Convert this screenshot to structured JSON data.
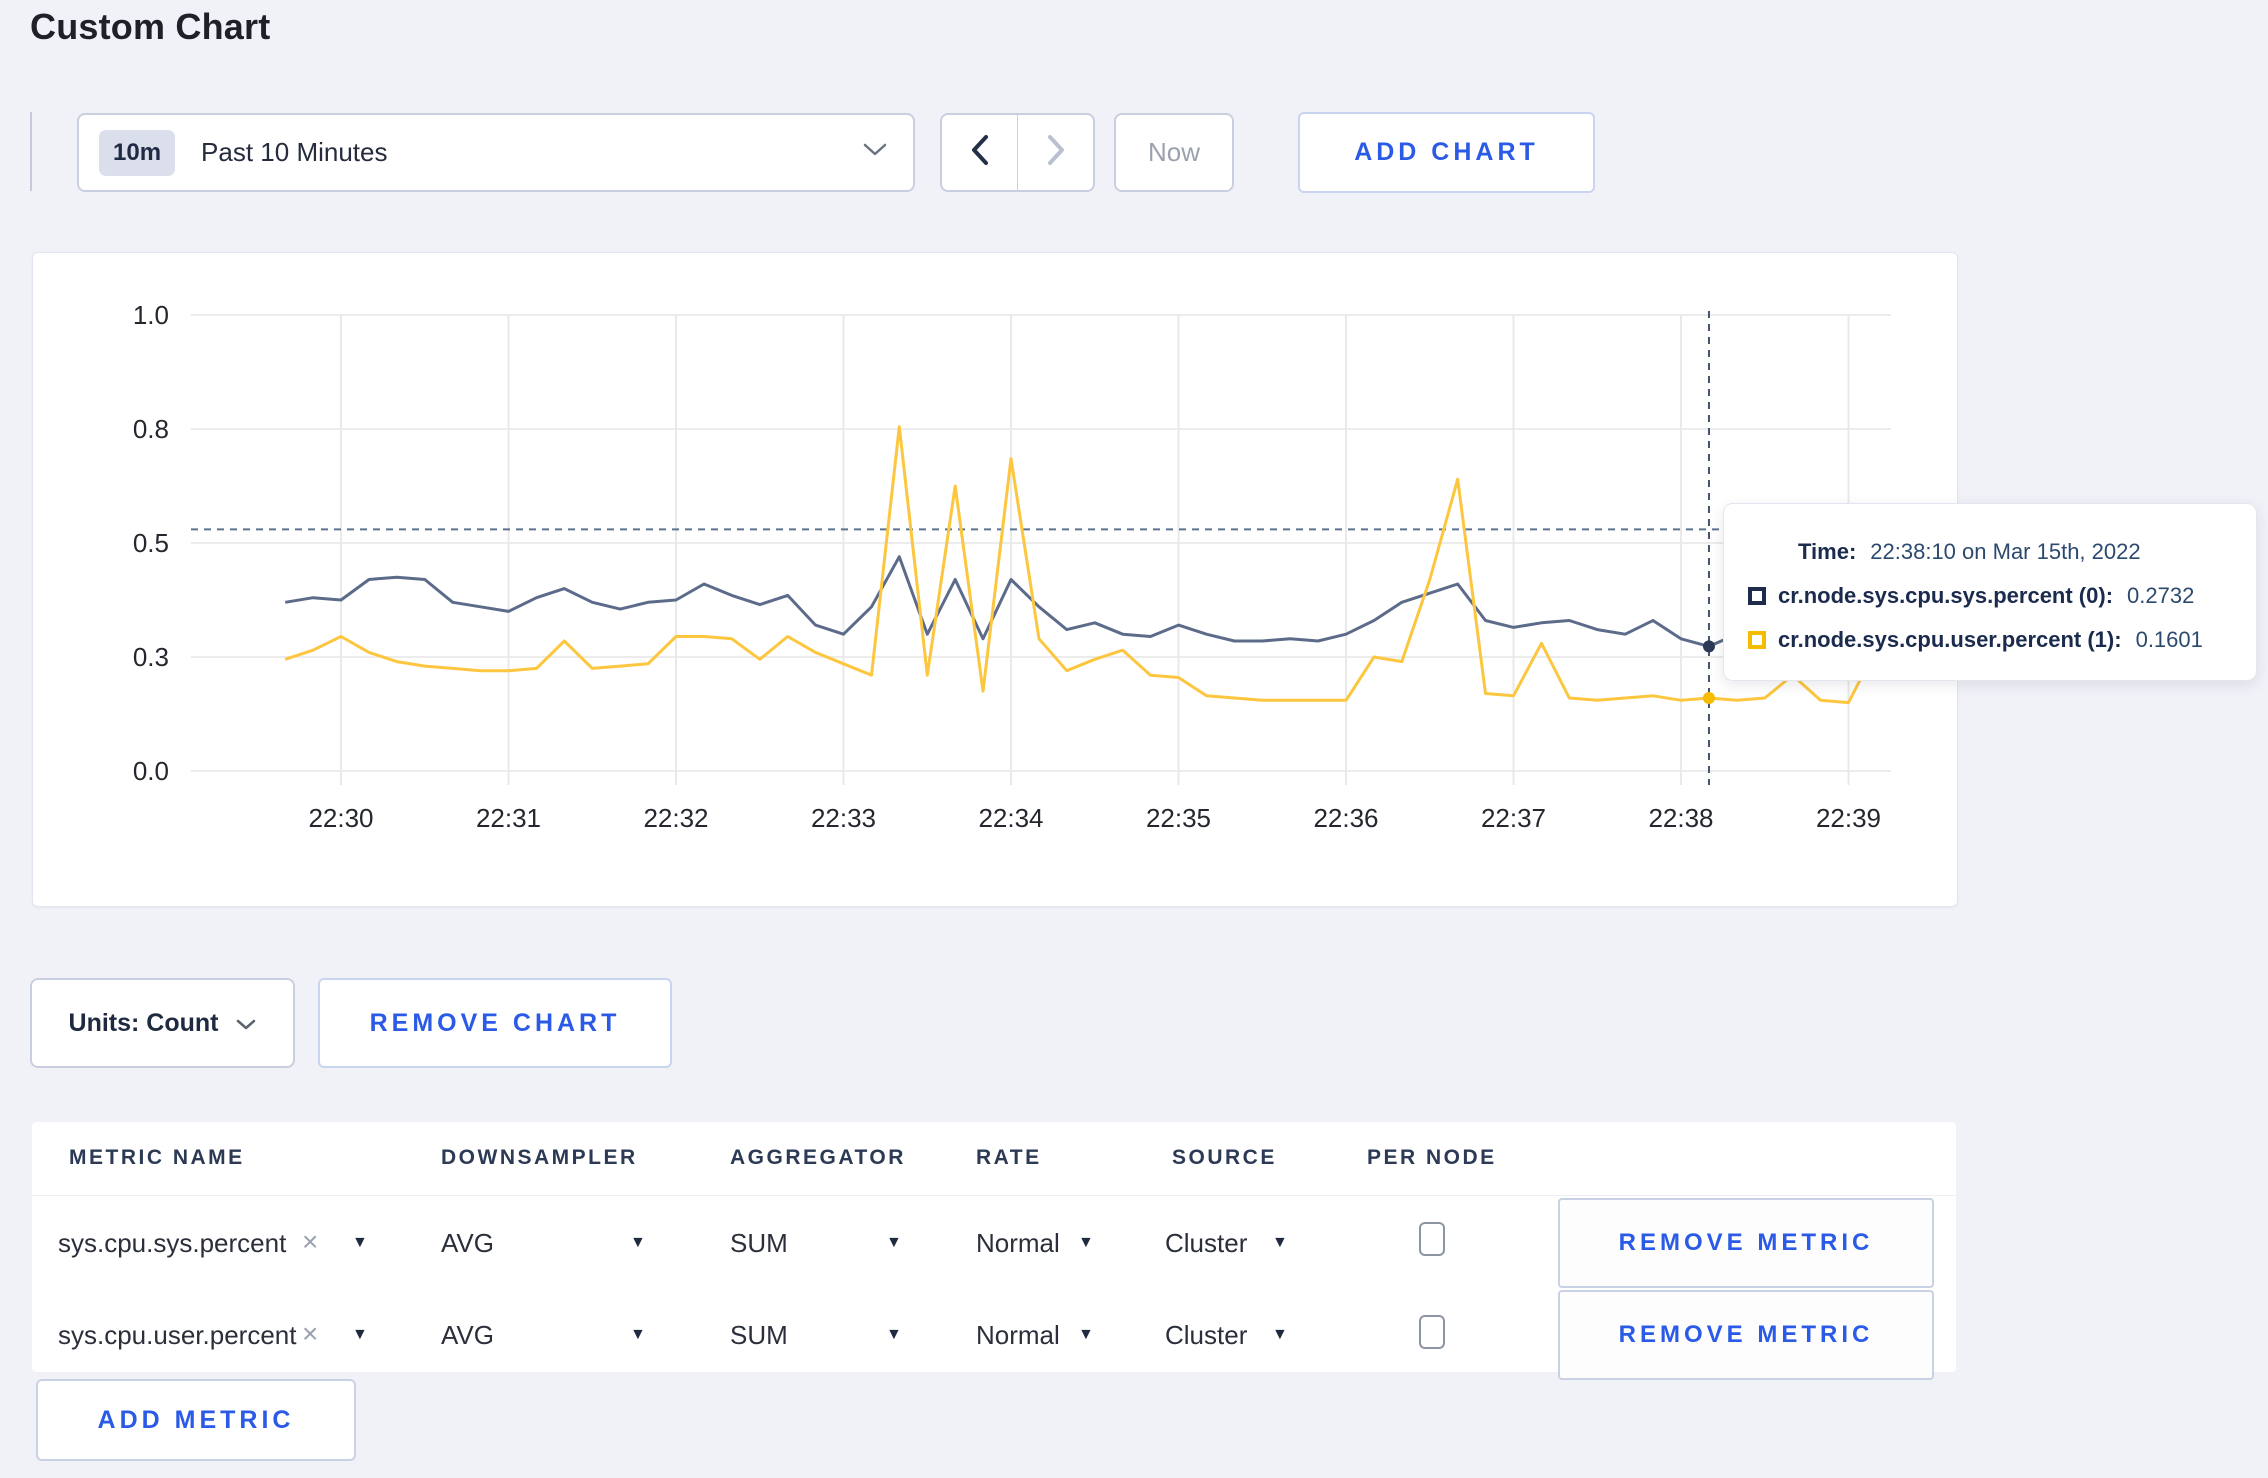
{
  "page": {
    "title": "Custom Chart"
  },
  "colors": {
    "background": "#f1f2f8",
    "accent_blue": "#2b5be6",
    "series_sys": "#5c6b8a",
    "series_user": "#fdc63f",
    "tooltip_swatch_sys": "#1e2b4d",
    "tooltip_swatch_user": "#f5bc00",
    "gridline": "#ececec",
    "crosshair": "#5b7390"
  },
  "icons": {
    "caret_down": "▼",
    "close": "×",
    "chevron_left": "chevron-left",
    "chevron_right": "chevron-right",
    "chevron_down": "chevron-down"
  },
  "toolbar": {
    "time_window_badge": "10m",
    "time_window_label": "Past 10 Minutes",
    "now_label": "Now",
    "add_chart_label": "ADD CHART"
  },
  "chart_data": {
    "type": "line",
    "title": "",
    "xlabel": "",
    "ylabel": "",
    "ylim": [
      0,
      1
    ],
    "x_ticks": [
      "22:30",
      "22:31",
      "22:32",
      "22:33",
      "22:34",
      "22:35",
      "22:36",
      "22:37",
      "22:38",
      "22:39"
    ],
    "y_ticks": [
      {
        "value": 0.0,
        "label": "0.0"
      },
      {
        "value": 0.25,
        "label": "0.3"
      },
      {
        "value": 0.5,
        "label": "0.5"
      },
      {
        "value": 0.75,
        "label": "0.8"
      },
      {
        "value": 1.0,
        "label": "1.0"
      }
    ],
    "grid": true,
    "series": [
      {
        "name": "cr.node.sys.cpu.sys.percent (0)",
        "color": "#5c6b8a",
        "points": [
          [
            -0.333,
            0.37
          ],
          [
            -0.167,
            0.38
          ],
          [
            0,
            0.375
          ],
          [
            0.167,
            0.42
          ],
          [
            0.333,
            0.425
          ],
          [
            0.5,
            0.42
          ],
          [
            0.667,
            0.37
          ],
          [
            0.833,
            0.36
          ],
          [
            1,
            0.35
          ],
          [
            1.167,
            0.38
          ],
          [
            1.333,
            0.4
          ],
          [
            1.5,
            0.37
          ],
          [
            1.667,
            0.355
          ],
          [
            1.833,
            0.37
          ],
          [
            2,
            0.375
          ],
          [
            2.167,
            0.41
          ],
          [
            2.333,
            0.385
          ],
          [
            2.5,
            0.365
          ],
          [
            2.667,
            0.385
          ],
          [
            2.833,
            0.32
          ],
          [
            3,
            0.3
          ],
          [
            3.167,
            0.36
          ],
          [
            3.333,
            0.47
          ],
          [
            3.5,
            0.3
          ],
          [
            3.667,
            0.42
          ],
          [
            3.833,
            0.29
          ],
          [
            4,
            0.42
          ],
          [
            4.167,
            0.36
          ],
          [
            4.333,
            0.31
          ],
          [
            4.5,
            0.325
          ],
          [
            4.667,
            0.3
          ],
          [
            4.833,
            0.295
          ],
          [
            5,
            0.32
          ],
          [
            5.167,
            0.3
          ],
          [
            5.333,
            0.285
          ],
          [
            5.5,
            0.285
          ],
          [
            5.667,
            0.29
          ],
          [
            5.833,
            0.285
          ],
          [
            6,
            0.3
          ],
          [
            6.167,
            0.33
          ],
          [
            6.333,
            0.37
          ],
          [
            6.5,
            0.39
          ],
          [
            6.667,
            0.41
          ],
          [
            6.833,
            0.33
          ],
          [
            7,
            0.315
          ],
          [
            7.167,
            0.325
          ],
          [
            7.333,
            0.33
          ],
          [
            7.5,
            0.31
          ],
          [
            7.667,
            0.3
          ],
          [
            7.833,
            0.33
          ],
          [
            8,
            0.29
          ],
          [
            8.167,
            0.2732
          ],
          [
            8.333,
            0.3
          ],
          [
            8.5,
            0.31
          ],
          [
            8.667,
            0.3
          ],
          [
            8.833,
            0.295
          ],
          [
            9,
            0.3
          ],
          [
            9.167,
            0.3
          ],
          [
            9.25,
            0.28
          ]
        ]
      },
      {
        "name": "cr.node.sys.cpu.user.percent (1)",
        "color": "#fdc63f",
        "points": [
          [
            -0.333,
            0.245
          ],
          [
            -0.167,
            0.265
          ],
          [
            0,
            0.295
          ],
          [
            0.167,
            0.26
          ],
          [
            0.333,
            0.24
          ],
          [
            0.5,
            0.23
          ],
          [
            0.667,
            0.225
          ],
          [
            0.833,
            0.22
          ],
          [
            1,
            0.22
          ],
          [
            1.167,
            0.225
          ],
          [
            1.333,
            0.285
          ],
          [
            1.5,
            0.225
          ],
          [
            1.667,
            0.23
          ],
          [
            1.833,
            0.235
          ],
          [
            2,
            0.295
          ],
          [
            2.167,
            0.295
          ],
          [
            2.333,
            0.29
          ],
          [
            2.5,
            0.245
          ],
          [
            2.667,
            0.295
          ],
          [
            2.833,
            0.26
          ],
          [
            3,
            0.235
          ],
          [
            3.167,
            0.21
          ],
          [
            3.333,
            0.755
          ],
          [
            3.5,
            0.21
          ],
          [
            3.667,
            0.625
          ],
          [
            3.833,
            0.175
          ],
          [
            4,
            0.685
          ],
          [
            4.167,
            0.29
          ],
          [
            4.333,
            0.22
          ],
          [
            4.5,
            0.245
          ],
          [
            4.667,
            0.265
          ],
          [
            4.833,
            0.21
          ],
          [
            5,
            0.205
          ],
          [
            5.167,
            0.165
          ],
          [
            5.333,
            0.16
          ],
          [
            5.5,
            0.155
          ],
          [
            5.667,
            0.155
          ],
          [
            5.833,
            0.155
          ],
          [
            6,
            0.155
          ],
          [
            6.167,
            0.25
          ],
          [
            6.333,
            0.24
          ],
          [
            6.5,
            0.42
          ],
          [
            6.667,
            0.64
          ],
          [
            6.833,
            0.17
          ],
          [
            7,
            0.165
          ],
          [
            7.167,
            0.28
          ],
          [
            7.333,
            0.16
          ],
          [
            7.5,
            0.155
          ],
          [
            7.667,
            0.16
          ],
          [
            7.833,
            0.165
          ],
          [
            8,
            0.155
          ],
          [
            8.167,
            0.1601
          ],
          [
            8.333,
            0.155
          ],
          [
            8.5,
            0.16
          ],
          [
            8.667,
            0.21
          ],
          [
            8.833,
            0.155
          ],
          [
            9,
            0.15
          ],
          [
            9.167,
            0.27
          ],
          [
            9.25,
            0.28
          ]
        ]
      }
    ],
    "legend_position": "tooltip",
    "crosshair": {
      "x_min": 8.167,
      "y_value": 0.53
    }
  },
  "tooltip": {
    "time_label": "Time:",
    "time_value": "22:38:10 on Mar 15th, 2022",
    "entries": [
      {
        "name": "cr.node.sys.cpu.sys.percent (0):",
        "value": "0.2732"
      },
      {
        "name": "cr.node.sys.cpu.user.percent (1):",
        "value": "0.1601"
      }
    ]
  },
  "units": {
    "label": "Units: Count"
  },
  "remove_chart_label": "REMOVE CHART",
  "metrics_table": {
    "headers": [
      "METRIC NAME",
      "DOWNSAMPLER",
      "AGGREGATOR",
      "RATE",
      "SOURCE",
      "PER NODE"
    ],
    "rows": [
      {
        "name": "sys.cpu.sys.percent",
        "downsampler": "AVG",
        "aggregator": "SUM",
        "rate": "Normal",
        "source": "Cluster",
        "per_node_checked": false
      },
      {
        "name": "sys.cpu.user.percent",
        "downsampler": "AVG",
        "aggregator": "SUM",
        "rate": "Normal",
        "source": "Cluster",
        "per_node_checked": false
      }
    ],
    "remove_metric_label": "REMOVE METRIC",
    "add_metric_label": "ADD METRIC"
  }
}
